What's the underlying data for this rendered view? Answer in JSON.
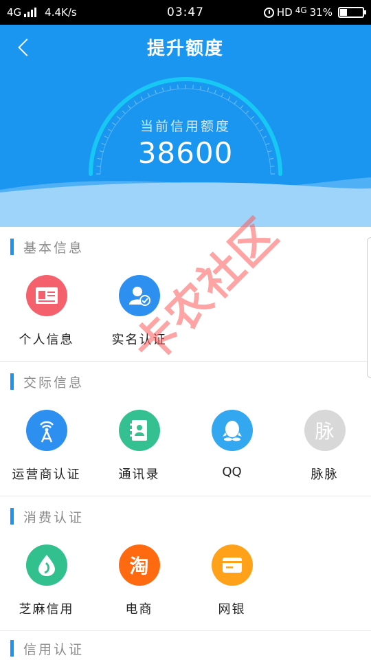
{
  "status_bar": {
    "network": "4G",
    "speed": "4.4K/s",
    "time": "03:47",
    "hd": "HD",
    "network_right": "4G",
    "battery": "31%",
    "battery_level": 0.31
  },
  "header": {
    "title": "提升额度",
    "credit_label": "当前信用额度",
    "credit_value": "38600"
  },
  "sections": [
    {
      "title": "基本信息",
      "items": [
        {
          "label": "个人信息",
          "icon": "id-card-icon",
          "color": "#f4606c"
        },
        {
          "label": "实名认证",
          "icon": "user-verified-icon",
          "color": "#2d8ff0"
        }
      ]
    },
    {
      "title": "交际信息",
      "items": [
        {
          "label": "运营商认证",
          "icon": "signal-tower-icon",
          "color": "#2d8ff0"
        },
        {
          "label": "通讯录",
          "icon": "contacts-book-icon",
          "color": "#34c091"
        },
        {
          "label": "QQ",
          "icon": "qq-icon",
          "color": "#33a8f0"
        },
        {
          "label": "脉脉",
          "icon": "maimai-icon",
          "icon_text": "脉",
          "color": "#d8d8d8"
        }
      ]
    },
    {
      "title": "消费认证",
      "items": [
        {
          "label": "芝麻信用",
          "icon": "sesame-icon",
          "color": "#31c08e"
        },
        {
          "label": "电商",
          "icon": "taobao-icon",
          "icon_text": "淘",
          "color": "#ff6a10"
        },
        {
          "label": "网银",
          "icon": "bank-card-icon",
          "color": "#ffa21a"
        }
      ]
    },
    {
      "title": "信用认证",
      "items": []
    }
  ],
  "watermark": "卡农社区",
  "colors": {
    "primary": "#1a96f0",
    "wave_light": "#9ed3fa",
    "wave_mid": "#5db7f6"
  }
}
